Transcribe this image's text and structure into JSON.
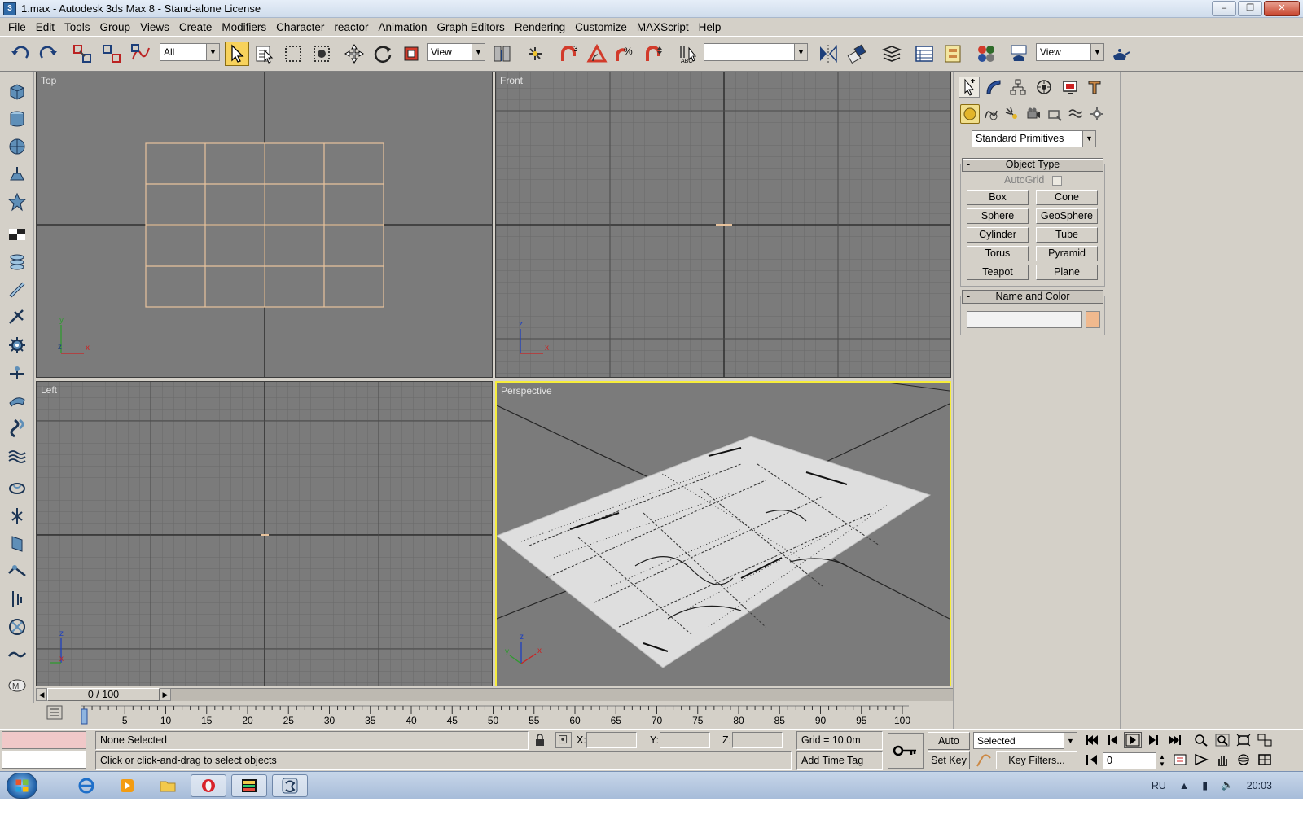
{
  "window": {
    "title": "1.max - Autodesk 3ds Max 8  - Stand-alone License",
    "app_icon_glyph": "3",
    "controls": {
      "minimize": "–",
      "maximize": "❐",
      "close": "✕"
    }
  },
  "menu": [
    "File",
    "Edit",
    "Tools",
    "Group",
    "Views",
    "Create",
    "Modifiers",
    "Character",
    "reactor",
    "Animation",
    "Graph Editors",
    "Rendering",
    "Customize",
    "MAXScript",
    "Help"
  ],
  "toolbar": {
    "selection_filter": "All",
    "ref_coord": "View",
    "named_selection": "",
    "render_view": "View"
  },
  "viewports": {
    "top": {
      "label": "Top",
      "axis_v": "y",
      "axis_h": "x",
      "axis_o": "z"
    },
    "front": {
      "label": "Front",
      "axis_v": "z",
      "axis_h": "x"
    },
    "left": {
      "label": "Left",
      "axis_v": "z",
      "axis_h": "x"
    },
    "perspective": {
      "label": "Perspective",
      "axis_v": "z",
      "axis_h": "x",
      "axis_d": "y"
    }
  },
  "command_panel": {
    "category": "Standard Primitives",
    "object_type_title": "Object Type",
    "autogrid": "AutoGrid",
    "buttons": [
      "Box",
      "Cone",
      "Sphere",
      "GeoSphere",
      "Cylinder",
      "Tube",
      "Torus",
      "Pyramid",
      "Teapot",
      "Plane"
    ],
    "name_color_title": "Name and Color",
    "collapse": "-",
    "object_color": "#f0b98e"
  },
  "time_slider": {
    "frame_readout": "0 / 100",
    "ticks": [
      "0",
      "5",
      "10",
      "15",
      "20",
      "25",
      "30",
      "35",
      "40",
      "45",
      "50",
      "55",
      "60",
      "65",
      "70",
      "75",
      "80",
      "85",
      "90",
      "95",
      "100"
    ]
  },
  "status": {
    "selection": "None Selected",
    "prompt": "Click or click-and-drag to select objects",
    "x_label": "X:",
    "y_label": "Y:",
    "z_label": "Z:",
    "grid": "Grid = 10,0m",
    "add_time_tag": "Add Time Tag",
    "auto_key": "Auto Key",
    "set_key": "Set Key",
    "key_mode": "Selected",
    "key_filters": "Key Filters...",
    "current_frame": "0"
  },
  "taskbar": {
    "language": "RU",
    "clock": "20:03"
  },
  "colors": {
    "viewport_bg": "#7b7b7b",
    "active_viewport": "#f6ed3a",
    "selected_tool": "#f7d25c",
    "plane_wire": "#e8c39d"
  }
}
